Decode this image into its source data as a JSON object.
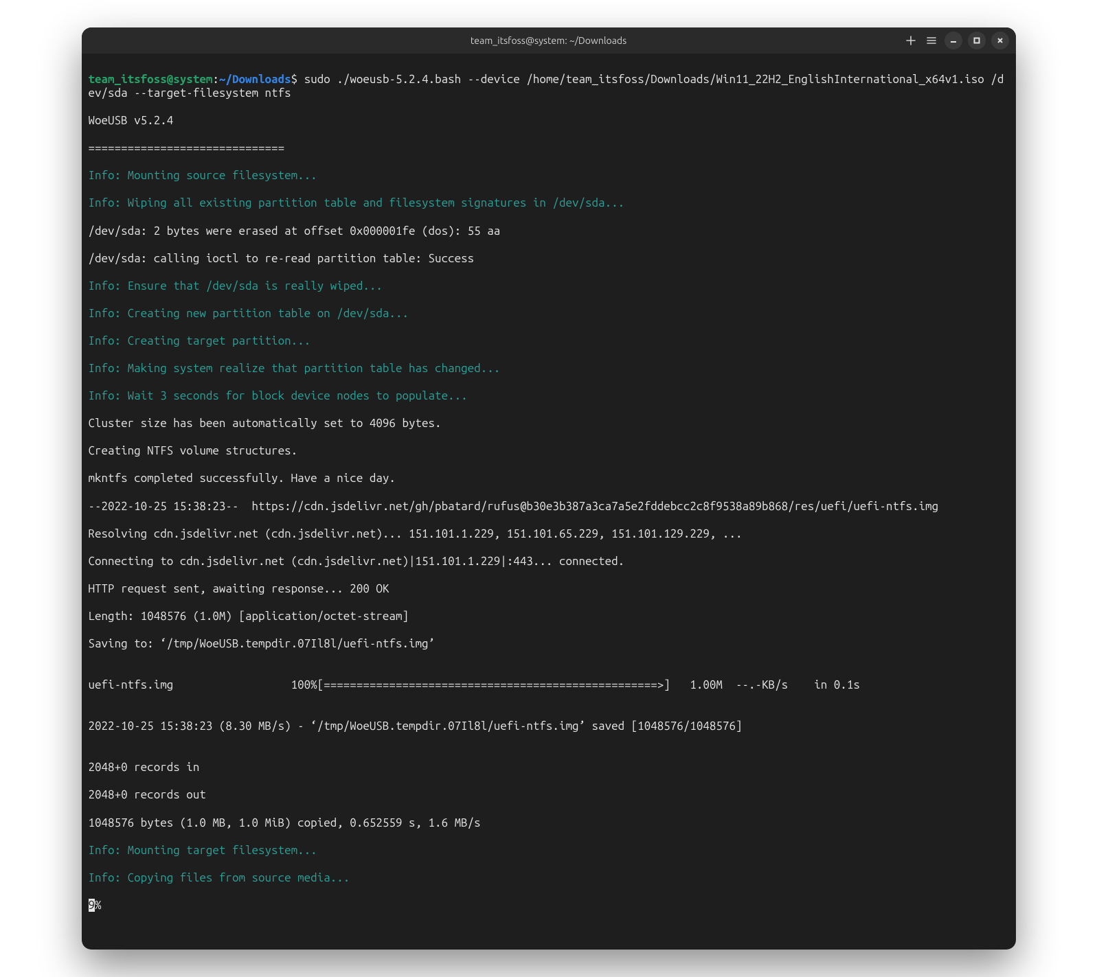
{
  "window": {
    "title": "team_itsfoss@system: ~/Downloads"
  },
  "titlebar": {
    "new_tab_tooltip": "New Tab",
    "menu_tooltip": "Menu"
  },
  "prompt": {
    "user_host": "team_itsfoss@system",
    "colon": ":",
    "cwd": "~/Downloads",
    "dollar": "$ ",
    "command": "sudo ./woeusb-5.2.4.bash --device /home/team_itsfoss/Downloads/Win11_22H2_EnglishInternational_x64v1.iso /dev/sda --target-filesystem ntfs"
  },
  "lines": {
    "l01": "WoeUSB v5.2.4",
    "l02": "==============================",
    "l03": "Info: Mounting source filesystem...",
    "l04": "Info: Wiping all existing partition table and filesystem signatures in /dev/sda...",
    "l05": "/dev/sda: 2 bytes were erased at offset 0x000001fe (dos): 55 aa",
    "l06": "/dev/sda: calling ioctl to re-read partition table: Success",
    "l07": "Info: Ensure that /dev/sda is really wiped...",
    "l08": "Info: Creating new partition table on /dev/sda...",
    "l09": "Info: Creating target partition...",
    "l10": "Info: Making system realize that partition table has changed...",
    "l11": "Info: Wait 3 seconds for block device nodes to populate...",
    "l12": "Cluster size has been automatically set to 4096 bytes.",
    "l13": "Creating NTFS volume structures.",
    "l14": "mkntfs completed successfully. Have a nice day.",
    "l15": "--2022-10-25 15:38:23--  https://cdn.jsdelivr.net/gh/pbatard/rufus@b30e3b387a3ca7a5e2fddebcc2c8f9538a89b868/res/uefi/uefi-ntfs.img",
    "l16": "Resolving cdn.jsdelivr.net (cdn.jsdelivr.net)... 151.101.1.229, 151.101.65.229, 151.101.129.229, ...",
    "l17": "Connecting to cdn.jsdelivr.net (cdn.jsdelivr.net)|151.101.1.229|:443... connected.",
    "l18": "HTTP request sent, awaiting response... 200 OK",
    "l19": "Length: 1048576 (1.0M) [application/octet-stream]",
    "l20": "Saving to: ‘/tmp/WoeUSB.tempdir.07Il8l/uefi-ntfs.img’",
    "l21": "",
    "l22": "uefi-ntfs.img                  100%[===================================================>]   1.00M  --.-KB/s    in 0.1s",
    "l23": "",
    "l24": "2022-10-25 15:38:23 (8.30 MB/s) - ‘/tmp/WoeUSB.tempdir.07Il8l/uefi-ntfs.img’ saved [1048576/1048576]",
    "l25": "",
    "l26": "2048+0 records in",
    "l27": "2048+0 records out",
    "l28": "1048576 bytes (1.0 MB, 1.0 MiB) copied, 0.652559 s, 1.6 MB/s",
    "l29": "Info: Mounting target filesystem...",
    "l30": "Info: Copying files from source media...",
    "progress_pct": "9",
    "progress_sign": "%"
  }
}
